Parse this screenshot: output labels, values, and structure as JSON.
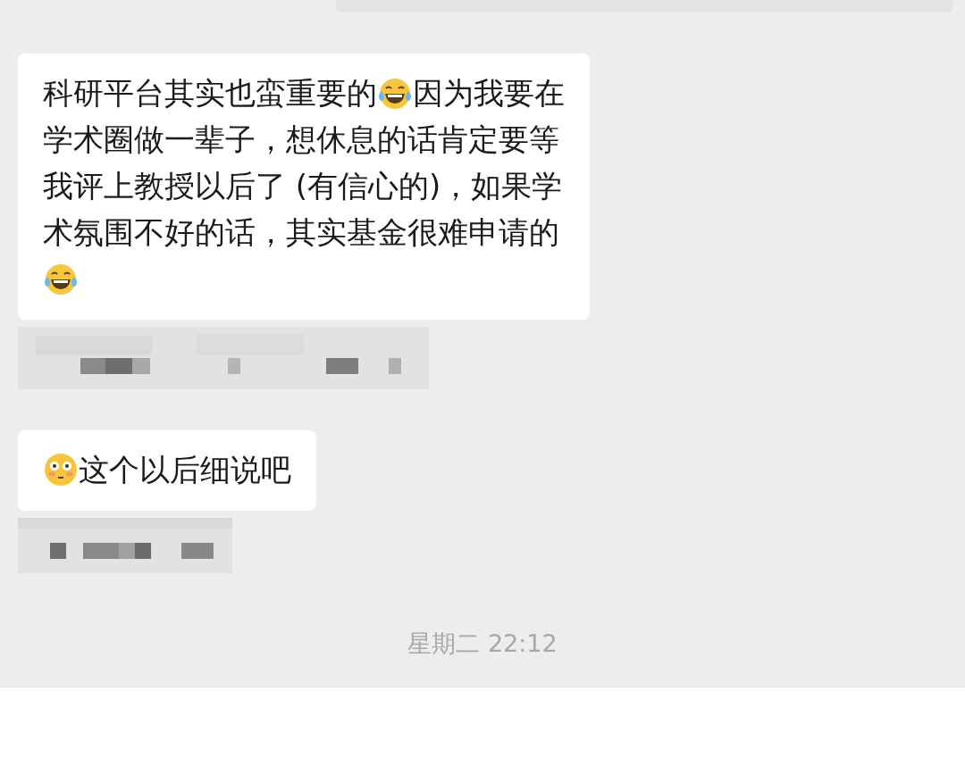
{
  "items": [
    {
      "kind": "bubble",
      "lines": [
        [
          {
            "kind": "text",
            "text": "科研平台其实也蛮重要的"
          },
          {
            "kind": "laughing"
          },
          {
            "kind": "text",
            "text": "因为我要在"
          }
        ],
        [
          {
            "kind": "text",
            "text": "学术圈做一辈子，想休息的话肯定要等"
          }
        ],
        [
          {
            "kind": "text",
            "text": "我评上教授以后了 (有信心的)，如果学"
          }
        ],
        [
          {
            "kind": "text",
            "text": "术氛围不好的话，其实基金很难申请的"
          }
        ],
        [
          {
            "kind": "laughing"
          }
        ]
      ]
    },
    {
      "kind": "mosaic"
    },
    {
      "kind": "bubble",
      "lines": [
        [
          {
            "kind": "flushed"
          },
          {
            "kind": "text",
            "text": "这个以后细说吧"
          }
        ]
      ]
    },
    {
      "kind": "mosaic"
    }
  ],
  "timestamp": "星期二 22:12"
}
